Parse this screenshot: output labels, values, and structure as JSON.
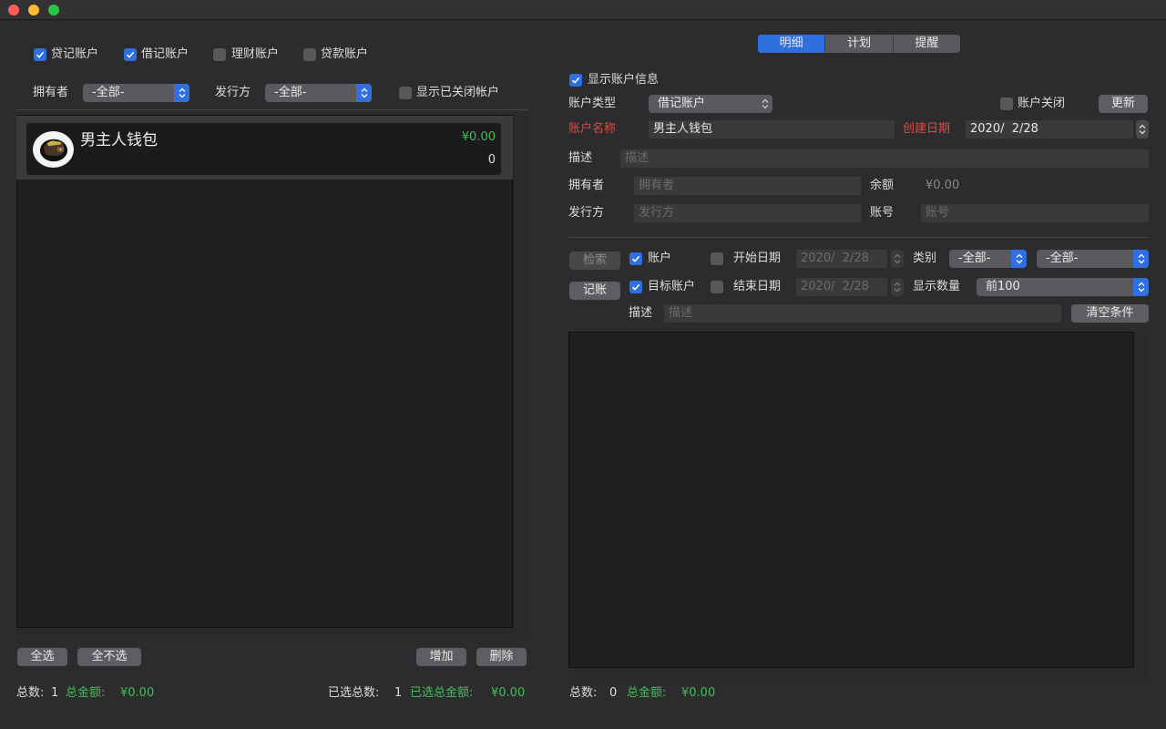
{
  "left": {
    "filters": {
      "credit_label": "贷记账户",
      "debit_label": "借记账户",
      "wealth_label": "理财账户",
      "loan_label": "贷款账户"
    },
    "owner_label": "拥有者",
    "owner_value": "-全部-",
    "issuer_label": "发行方",
    "issuer_value": "-全部-",
    "show_closed_label": "显示已关闭帐户",
    "accounts": [
      {
        "name": "男主人钱包",
        "balance": "¥0.00",
        "count": "0"
      }
    ],
    "select_all_label": "全选",
    "deselect_all_label": "全不选",
    "add_label": "增加",
    "delete_label": "删除",
    "footer": {
      "total_count_label": "总数:",
      "total_count": "1",
      "total_amount_label": "总金额:",
      "total_amount": "¥0.00",
      "selected_count_label": "已选总数:",
      "selected_count": "1",
      "selected_amount_label": "已选总金额:",
      "selected_amount": "¥0.00"
    }
  },
  "right": {
    "tabs": [
      {
        "label": "明细",
        "selected": true
      },
      {
        "label": "计划",
        "selected": false
      },
      {
        "label": "提醒",
        "selected": false
      }
    ],
    "show_info_label": "显示账户信息",
    "account_type_label": "账户类型",
    "account_type_value": "借记账户",
    "account_closed_label": "账户关闭",
    "update_label": "更新",
    "account_name_label": "账户名称",
    "account_name_value": "男主人钱包",
    "created_date_label": "创建日期",
    "created_date_value": "2020/  2/28",
    "description_label": "描述",
    "description_placeholder": "描述",
    "owner_label": "拥有者",
    "owner_placeholder": "拥有者",
    "balance_label": "余额",
    "balance_value": "¥0.00",
    "issuer_label": "发行方",
    "issuer_placeholder": "发行方",
    "account_no_label": "账号",
    "account_no_placeholder": "账号",
    "search_label": "检索",
    "record_label": "记账",
    "account_check_label": "账户",
    "target_account_label": "目标账户",
    "start_date_label": "开始日期",
    "start_date_value": "2020/  2/28",
    "end_date_label": "结束日期",
    "end_date_value": "2020/  2/28",
    "category_label": "类别",
    "category_value1": "-全部-",
    "category_value2": "-全部-",
    "show_count_label": "显示数量",
    "show_count_value": "前100",
    "desc_filter_label": "描述",
    "desc_filter_placeholder": "描述",
    "clear_label": "清空条件",
    "footer": {
      "total_count_label": "总数:",
      "total_count": "0",
      "total_amount_label": "总金额:",
      "total_amount": "¥0.00"
    }
  },
  "colors": {
    "accent": "#2f6fe0",
    "green": "#3fbf56",
    "red": "#e5483c"
  }
}
